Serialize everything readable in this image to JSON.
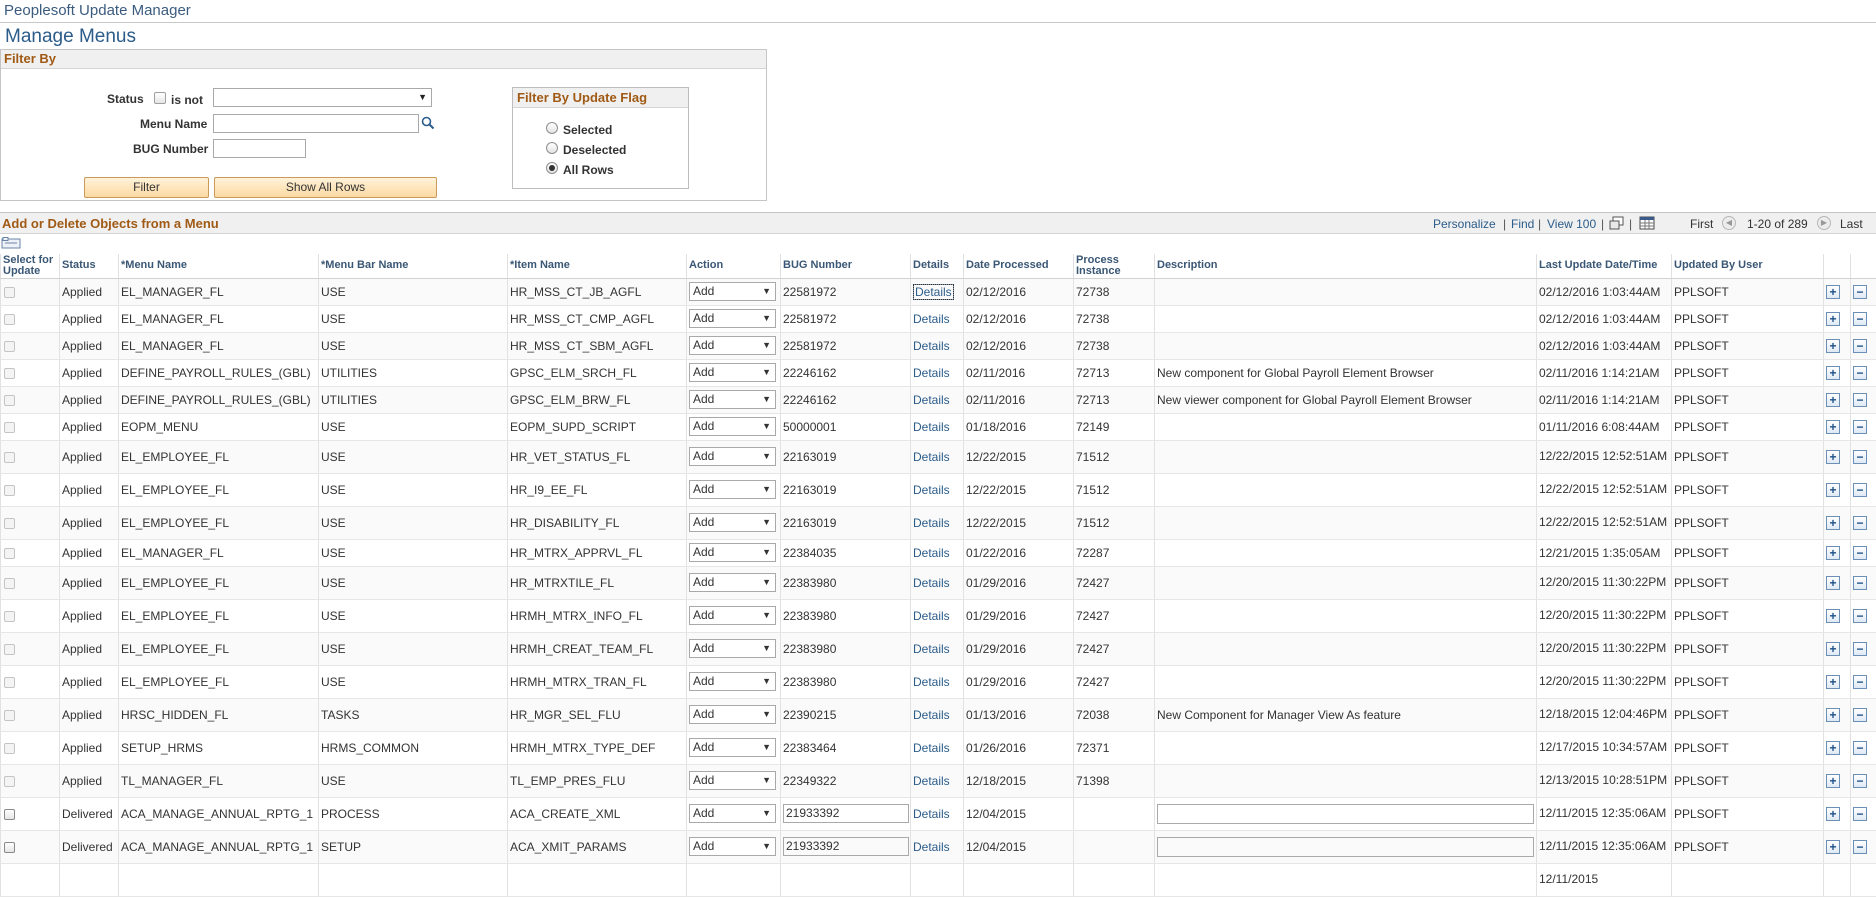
{
  "app_title": "Peoplesoft Update Manager",
  "page_title": "Manage Menus",
  "filter": {
    "section_title": "Filter By",
    "status_label": "Status",
    "is_not_label": "is not",
    "status_value": "",
    "menu_name_label": "Menu Name",
    "menu_name_value": "",
    "bug_number_label": "BUG Number",
    "bug_number_value": "",
    "filter_button": "Filter",
    "show_all_button": "Show All Rows",
    "update_flag": {
      "title": "Filter By Update Flag",
      "options": [
        "Selected",
        "Deselected",
        "All Rows"
      ],
      "selected": "All Rows"
    }
  },
  "grid": {
    "title": "Add or Delete Objects from a Menu",
    "nav": {
      "personalize": "Personalize",
      "find": "Find",
      "view100": "View 100",
      "first": "First",
      "range": "1-20 of 289",
      "last": "Last"
    },
    "columns": {
      "select": "Select for Update",
      "status": "Status",
      "menu_name": "*Menu Name",
      "menu_bar_name": "*Menu Bar Name",
      "item_name": "*Item Name",
      "action": "Action",
      "bug_number": "BUG Number",
      "details": "Details",
      "date_processed": "Date Processed",
      "process_instance": "Process Instance",
      "description": "Description",
      "last_update": "Last Update Date/Time",
      "updated_by": "Updated By User"
    },
    "rows": [
      {
        "status": "Applied",
        "menu": "EL_MANAGER_FL",
        "bar": "USE",
        "item": "HR_MSS_CT_JB_AGFL",
        "action": "Add",
        "bug": "22581972",
        "details": "Details",
        "date": "02/12/2016",
        "inst": "72738",
        "desc": "",
        "last": "02/12/2016  1:03:44AM",
        "user": "PPLSOFT"
      },
      {
        "status": "Applied",
        "menu": "EL_MANAGER_FL",
        "bar": "USE",
        "item": "HR_MSS_CT_CMP_AGFL",
        "action": "Add",
        "bug": "22581972",
        "details": "Details",
        "date": "02/12/2016",
        "inst": "72738",
        "desc": "",
        "last": "02/12/2016  1:03:44AM",
        "user": "PPLSOFT"
      },
      {
        "status": "Applied",
        "menu": "EL_MANAGER_FL",
        "bar": "USE",
        "item": "HR_MSS_CT_SBM_AGFL",
        "action": "Add",
        "bug": "22581972",
        "details": "Details",
        "date": "02/12/2016",
        "inst": "72738",
        "desc": "",
        "last": "02/12/2016  1:03:44AM",
        "user": "PPLSOFT"
      },
      {
        "status": "Applied",
        "menu": "DEFINE_PAYROLL_RULES_(GBL)",
        "bar": "UTILITIES",
        "item": "GPSC_ELM_SRCH_FL",
        "action": "Add",
        "bug": "22246162",
        "details": "Details",
        "date": "02/11/2016",
        "inst": "72713",
        "desc": "New component for Global Payroll Element Browser",
        "last": "02/11/2016  1:14:21AM",
        "user": "PPLSOFT"
      },
      {
        "status": "Applied",
        "menu": "DEFINE_PAYROLL_RULES_(GBL)",
        "bar": "UTILITIES",
        "item": "GPSC_ELM_BRW_FL",
        "action": "Add",
        "bug": "22246162",
        "details": "Details",
        "date": "02/11/2016",
        "inst": "72713",
        "desc": "New viewer component for Global Payroll Element Browser",
        "last": "02/11/2016  1:14:21AM",
        "user": "PPLSOFT"
      },
      {
        "status": "Applied",
        "menu": "EOPM_MENU",
        "bar": "USE",
        "item": "EOPM_SUPD_SCRIPT",
        "action": "Add",
        "bug": "50000001",
        "details": "Details",
        "date": "01/18/2016",
        "inst": "72149",
        "desc": "",
        "last": "01/11/2016  6:08:44AM",
        "user": "PPLSOFT"
      },
      {
        "status": "Applied",
        "menu": "EL_EMPLOYEE_FL",
        "bar": "USE",
        "item": "HR_VET_STATUS_FL",
        "action": "Add",
        "bug": "22163019",
        "details": "Details",
        "date": "12/22/2015",
        "inst": "71512",
        "desc": "",
        "last": "12/22/2015 12:52:51AM",
        "user": "PPLSOFT"
      },
      {
        "status": "Applied",
        "menu": "EL_EMPLOYEE_FL",
        "bar": "USE",
        "item": "HR_I9_EE_FL",
        "action": "Add",
        "bug": "22163019",
        "details": "Details",
        "date": "12/22/2015",
        "inst": "71512",
        "desc": "",
        "last": "12/22/2015 12:52:51AM",
        "user": "PPLSOFT"
      },
      {
        "status": "Applied",
        "menu": "EL_EMPLOYEE_FL",
        "bar": "USE",
        "item": "HR_DISABILITY_FL",
        "action": "Add",
        "bug": "22163019",
        "details": "Details",
        "date": "12/22/2015",
        "inst": "71512",
        "desc": "",
        "last": "12/22/2015 12:52:51AM",
        "user": "PPLSOFT"
      },
      {
        "status": "Applied",
        "menu": "EL_MANAGER_FL",
        "bar": "USE",
        "item": "HR_MTRX_APPRVL_FL",
        "action": "Add",
        "bug": "22384035",
        "details": "Details",
        "date": "01/22/2016",
        "inst": "72287",
        "desc": "",
        "last": "12/21/2015  1:35:05AM",
        "user": "PPLSOFT"
      },
      {
        "status": "Applied",
        "menu": "EL_EMPLOYEE_FL",
        "bar": "USE",
        "item": "HR_MTRXTILE_FL",
        "action": "Add",
        "bug": "22383980",
        "details": "Details",
        "date": "01/29/2016",
        "inst": "72427",
        "desc": "",
        "last": "12/20/2015 11:30:22PM",
        "user": "PPLSOFT"
      },
      {
        "status": "Applied",
        "menu": "EL_EMPLOYEE_FL",
        "bar": "USE",
        "item": "HRMH_MTRX_INFO_FL",
        "action": "Add",
        "bug": "22383980",
        "details": "Details",
        "date": "01/29/2016",
        "inst": "72427",
        "desc": "",
        "last": "12/20/2015 11:30:22PM",
        "user": "PPLSOFT"
      },
      {
        "status": "Applied",
        "menu": "EL_EMPLOYEE_FL",
        "bar": "USE",
        "item": "HRMH_CREAT_TEAM_FL",
        "action": "Add",
        "bug": "22383980",
        "details": "Details",
        "date": "01/29/2016",
        "inst": "72427",
        "desc": "",
        "last": "12/20/2015 11:30:22PM",
        "user": "PPLSOFT"
      },
      {
        "status": "Applied",
        "menu": "EL_EMPLOYEE_FL",
        "bar": "USE",
        "item": "HRMH_MTRX_TRAN_FL",
        "action": "Add",
        "bug": "22383980",
        "details": "Details",
        "date": "01/29/2016",
        "inst": "72427",
        "desc": "",
        "last": "12/20/2015 11:30:22PM",
        "user": "PPLSOFT"
      },
      {
        "status": "Applied",
        "menu": "HRSC_HIDDEN_FL",
        "bar": "TASKS",
        "item": "HR_MGR_SEL_FLU",
        "action": "Add",
        "bug": "22390215",
        "details": "Details",
        "date": "01/13/2016",
        "inst": "72038",
        "desc": "New Component for Manager View As feature",
        "last": "12/18/2015 12:04:46PM",
        "user": "PPLSOFT"
      },
      {
        "status": "Applied",
        "menu": "SETUP_HRMS",
        "bar": "HRMS_COMMON",
        "item": "HRMH_MTRX_TYPE_DEF",
        "action": "Add",
        "bug": "22383464",
        "details": "Details",
        "date": "01/26/2016",
        "inst": "72371",
        "desc": "",
        "last": "12/17/2015 10:34:57AM",
        "user": "PPLSOFT"
      },
      {
        "status": "Applied",
        "menu": "TL_MANAGER_FL",
        "bar": "USE",
        "item": "TL_EMP_PRES_FLU",
        "action": "Add",
        "bug": "22349322",
        "details": "Details",
        "date": "12/18/2015",
        "inst": "71398",
        "desc": "",
        "last": "12/13/2015 10:28:51PM",
        "user": "PPLSOFT"
      },
      {
        "status": "Delivered",
        "menu": "ACA_MANAGE_ANNUAL_RPTG_1",
        "bar": "PROCESS",
        "item": "ACA_CREATE_XML",
        "action": "Add",
        "bug": "21933392",
        "details": "Details",
        "date": "12/04/2015",
        "inst": "",
        "desc": "",
        "last": "12/11/2015 12:35:06AM",
        "user": "PPLSOFT"
      },
      {
        "status": "Delivered",
        "menu": "ACA_MANAGE_ANNUAL_RPTG_1",
        "bar": "SETUP",
        "item": "ACA_XMIT_PARAMS",
        "action": "Add",
        "bug": "21933392",
        "details": "Details",
        "date": "12/04/2015",
        "inst": "",
        "desc": "",
        "last": "12/11/2015 12:35:06AM",
        "user": "PPLSOFT"
      },
      {
        "status": "",
        "menu": "",
        "bar": "",
        "item": "",
        "action": "",
        "bug": "",
        "details": "",
        "date": "",
        "inst": "",
        "desc": "",
        "last": "12/11/2015",
        "user": ""
      }
    ]
  }
}
